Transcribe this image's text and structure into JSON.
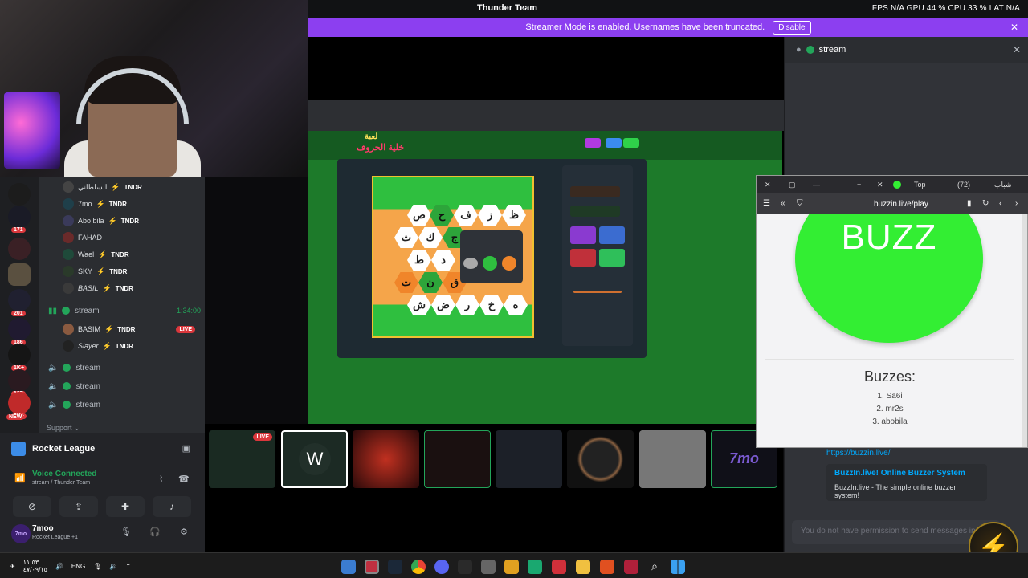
{
  "topbar": {
    "title": "Thunder Team",
    "stats": "FPS N/A   GPU 44 %   CPU 33 %   LAT N/A"
  },
  "streamer_banner": {
    "text": "Streamer Mode is enabled. Usernames have been truncated.",
    "button": "Disable"
  },
  "server_badges": [
    "171",
    "201",
    "186",
    "1K+",
    "137",
    "2K+",
    "NEW"
  ],
  "members": [
    {
      "name": "السلطاني",
      "tag": "TNDR"
    },
    {
      "name": "7mo",
      "tag": "TNDR"
    },
    {
      "name": "Abo bila",
      "tag": "TNDR"
    },
    {
      "name": "FAHAD",
      "tag": ""
    },
    {
      "name": "Wael",
      "tag": "TNDR"
    },
    {
      "name": "SKY",
      "tag": "TNDR"
    },
    {
      "name": "BASIL",
      "tag": "TNDR"
    }
  ],
  "stream_channel": {
    "name": "stream",
    "time": "1:34:00"
  },
  "stream_members": [
    {
      "name": "BASIM",
      "tag": "TNDR",
      "live": "LIVE"
    },
    {
      "name": "Slayer",
      "tag": "TNDR"
    }
  ],
  "voice_channels": [
    "stream",
    "stream",
    "stream"
  ],
  "support_label": "Support",
  "panel": {
    "game": "Rocket League",
    "voice_status": "Voice Connected",
    "voice_sub": "stream / Thunder Team",
    "user_name": "7moo",
    "user_sub": "Rocket League +1",
    "avatar_text": "7mo"
  },
  "thumb_live": "LIVE",
  "thumb_7mo": "7mo",
  "chat": {
    "header": "stream",
    "link": "https://buzzin.live/",
    "embed_title": "BuzzIn.live! Online Buzzer System",
    "embed_desc": "BuzzIn.live - The simple online buzzer system!",
    "input_placeholder": "You do not have permission to send messages in this channel."
  },
  "buzz": {
    "url": "buzzin.live/play",
    "tab1": "Top",
    "tab2": "(72)",
    "tab3": "شباب",
    "button": "BUZZ",
    "heading": "Buzzes:",
    "list": [
      "1. Sa6i",
      "2. mr2s",
      "3. abobila"
    ]
  },
  "game_logo": {
    "line1": "لعبة",
    "line2": "خلية الحروف"
  },
  "hex_letters": [
    "ص",
    "ح",
    "ف",
    "ز",
    "ظ",
    "ث",
    "ك",
    "ج",
    "ط",
    "د",
    "ت",
    "ن",
    "ق",
    "ش",
    "ض",
    "ر",
    "خ",
    "ه"
  ],
  "taskbar": {
    "time": "١١:٥٣",
    "date": "٤٧/٠٩/١٥",
    "lang": "ENG"
  }
}
